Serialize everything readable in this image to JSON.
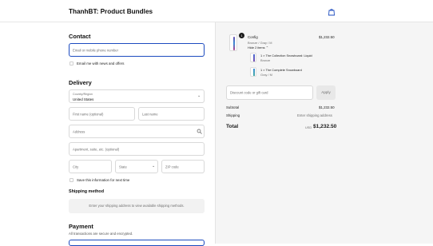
{
  "header": {
    "store_name": "ThanhBT: Product Bundles"
  },
  "contact": {
    "title": "Contact",
    "email_placeholder": "Email or mobile phone number",
    "news_label": "Email me with news and offers"
  },
  "delivery": {
    "title": "Delivery",
    "country_label": "Country/Region",
    "country_value": "United States",
    "first_name": "First name (optional)",
    "last_name": "Last name",
    "address": "Address",
    "apartment": "Apartment, suite, etc. (optional)",
    "city": "City",
    "state": "State",
    "zip": "ZIP code",
    "save_label": "Save this information for next time"
  },
  "shipping": {
    "title": "Shipping method",
    "note": "Enter your shipping address to view available shipping methods."
  },
  "payment": {
    "title": "Payment",
    "subtitle": "All transactions are secure and encrypted."
  },
  "summary": {
    "item": {
      "qty": "1",
      "name": "Config",
      "variant": "Bronze / Gray / M",
      "price": "$1,232.50",
      "hide_label": "Hide 2 items ⌃",
      "sub_items": [
        {
          "name": "1 × The Collection Snowboard: Liquid",
          "variant": "Bronze"
        },
        {
          "name": "1 × The Complete Snowboard",
          "variant": "Gray / M"
        }
      ]
    },
    "discount_placeholder": "Discount code or gift card",
    "apply_label": "Apply",
    "subtotal_label": "Subtotal",
    "subtotal_value": "$1,232.50",
    "shipping_label": "Shipping",
    "shipping_value": "Enter shipping address",
    "total_label": "Total",
    "currency": "USD",
    "total_value": "$1,232.50"
  }
}
